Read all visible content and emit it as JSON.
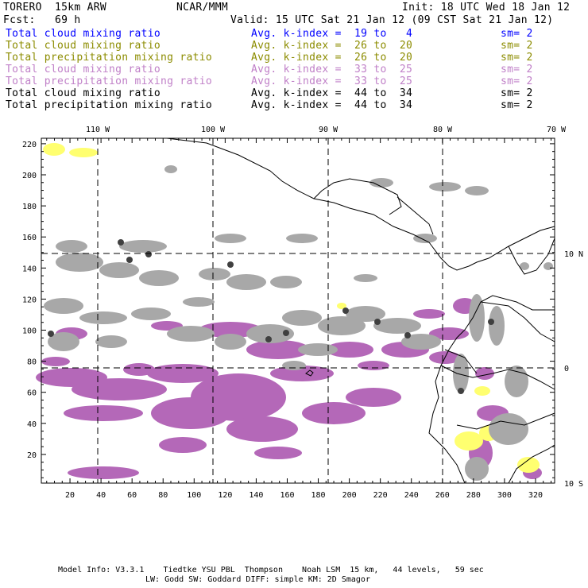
{
  "header": {
    "model": "TORERO  15km ARW",
    "org": "NCAR/MMM",
    "init": "Init: 18 UTC Wed 18 Jan 12",
    "fcst": "Fcst:   69 h",
    "valid": "Valid: 15 UTC Sat 21 Jan 12 (09 CST Sat 21 Jan 12)"
  },
  "legend": [
    {
      "field": "Total cloud mixing ratio",
      "kindex": "Avg. k-index =  19 to   4",
      "sm": "sm= 2",
      "color": "#0000ff"
    },
    {
      "field": "Total cloud mixing ratio",
      "kindex": "Avg. k-index =  26 to  20",
      "sm": "sm= 2",
      "color": "#8c8c00"
    },
    {
      "field": "Total precipitation mixing ratio",
      "kindex": "Avg. k-index =  26 to  20",
      "sm": "sm= 2",
      "color": "#8c8c00"
    },
    {
      "field": "Total cloud mixing ratio",
      "kindex": "Avg. k-index =  33 to  25",
      "sm": "sm= 2",
      "color": "#c080c8"
    },
    {
      "field": "Total precipitation mixing ratio",
      "kindex": "Avg. k-index =  33 to  25",
      "sm": "sm= 2",
      "color": "#c080c8"
    },
    {
      "field": "Total cloud mixing ratio",
      "kindex": "Avg. k-index =  44 to  34",
      "sm": "sm= 2",
      "color": "#000000"
    },
    {
      "field": "Total precipitation mixing ratio",
      "kindex": "Avg. k-index =  44 to  34",
      "sm": "sm= 2",
      "color": "#000000"
    }
  ],
  "axes": {
    "x_ticks": [
      "20",
      "40",
      "60",
      "80",
      "100",
      "120",
      "140",
      "160",
      "180",
      "200",
      "220",
      "240",
      "260",
      "280",
      "300",
      "320"
    ],
    "y_ticks": [
      "20",
      "40",
      "60",
      "80",
      "100",
      "120",
      "140",
      "160",
      "180",
      "200",
      "220"
    ],
    "lon_labels": [
      "110 W",
      "100 W",
      "90 W",
      "80 W",
      "70 W"
    ],
    "lat_labels": [
      "10 N",
      "0",
      "10 S"
    ]
  },
  "colors": {
    "gray": "#a8a8a8",
    "purple": "#b468b8",
    "yellow": "#ffff70",
    "dark": "#404040"
  },
  "footer": {
    "line1": "Model Info: V3.3.1    Tiedtke YSU PBL  Thompson    Noah LSM  15 km,   44 levels,   59 sec",
    "line2": "LW: Godd SW: Goddard DIFF: simple KM: 2D Smagor"
  }
}
